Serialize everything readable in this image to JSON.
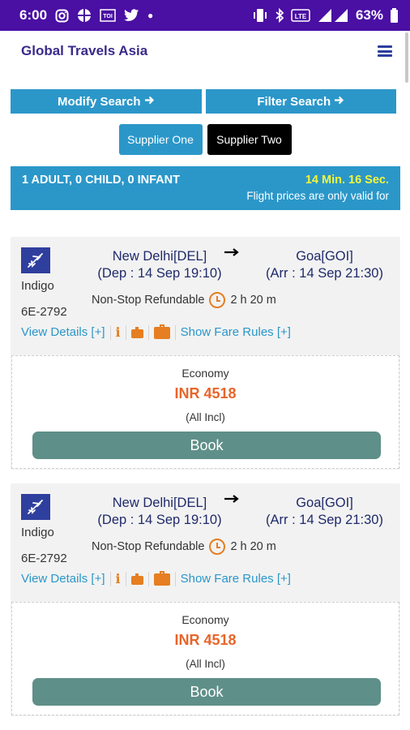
{
  "status_bar": {
    "time": "6:00",
    "battery": "63%"
  },
  "app": {
    "title": "Global Travels Asia"
  },
  "search_buttons": {
    "modify": "Modify Search",
    "filter": "Filter Search"
  },
  "suppliers": {
    "one": "Supplier One",
    "two": "Supplier Two"
  },
  "passengers": {
    "summary": "1 ADULT, 0 CHILD, 0 INFANT",
    "timer": "14 Min. 16 Sec.",
    "validity_note": "Flight prices are only valid for"
  },
  "flights": [
    {
      "airline": "Indigo",
      "flight_no": "6E-2792",
      "from": "New Delhi[DEL]",
      "dep": "(Dep : 14 Sep 19:10)",
      "to": "Goa[GOI]",
      "arr": "(Arr : 14 Sep 21:30)",
      "stops": "Non-Stop",
      "refund": "Refundable",
      "duration": "2 h 20 m",
      "view_details": "View Details [+]",
      "fare_rules": "Show Fare Rules [+]",
      "cabin": "Economy",
      "price": "INR 4518",
      "incl": "(All Incl)",
      "book": "Book"
    },
    {
      "airline": "Indigo",
      "flight_no": "6E-2792",
      "from": "New Delhi[DEL]",
      "dep": "(Dep : 14 Sep 19:10)",
      "to": "Goa[GOI]",
      "arr": "(Arr : 14 Sep 21:30)",
      "stops": "Non-Stop",
      "refund": "Refundable",
      "duration": "2 h 20 m",
      "view_details": "View Details [+]",
      "fare_rules": "Show Fare Rules [+]",
      "cabin": "Economy",
      "price": "INR 4518",
      "incl": "(All Incl)",
      "book": "Book"
    }
  ],
  "colors": {
    "statusbar": "#4a0fa3",
    "accent": "#2b97c9",
    "price": "#e8652a",
    "book": "#5f8f89",
    "timer": "#f5f53a"
  },
  "icons": [
    "instagram-icon",
    "globe-icon",
    "toi-icon",
    "twitter-icon",
    "vibrate-icon",
    "bluetooth-icon",
    "lte-icon",
    "signal-icon",
    "battery-icon",
    "menu-icon",
    "plane-icon",
    "clock-icon",
    "info-icon",
    "cabin-bag-icon",
    "checkin-bag-icon"
  ]
}
